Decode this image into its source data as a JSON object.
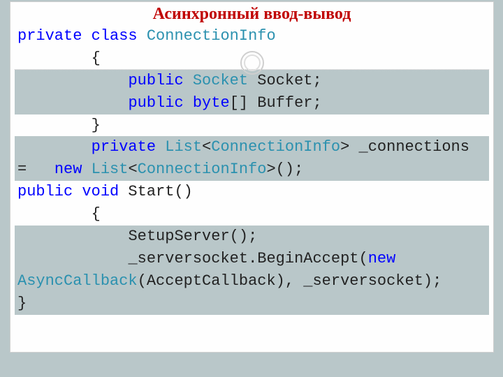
{
  "title": "Асинхронный ввод-вывод",
  "code": {
    "kw_private": "private",
    "kw_class": "class",
    "kw_public": "public",
    "kw_pub2": "public",
    "kw_pub3": "public",
    "kw_void": "void",
    "kw_new": "new",
    "kw_new2": "new",
    "type_conninfo": "ConnectionInfo",
    "type_conninfo2": "ConnectionInfo",
    "type_conninfo3": "ConnectionInfo",
    "type_socket": "Socket",
    "type_byte": "byte",
    "type_list": "List",
    "type_list2": "List",
    "type_asynccb": "AsyncCallback",
    "txt_socket_field": " Socket;",
    "txt_buffer_field": "[] Buffer;",
    "txt_brace_open": "{",
    "txt_brace_close": "}",
    "txt_lt": "<",
    "txt_gt": ">",
    "txt_conn_eq": " _connections =   ",
    "txt_paren_semicolon": ">();",
    "txt_start": " Start()",
    "txt_brace_open2": "{",
    "txt_setup": "SetupServer();",
    "txt_beginaccept": "_serversocket.BeginAccept(",
    "txt_acceptcb": "(AcceptCallback), _serversocket);           }",
    "kw_private2": "private"
  }
}
